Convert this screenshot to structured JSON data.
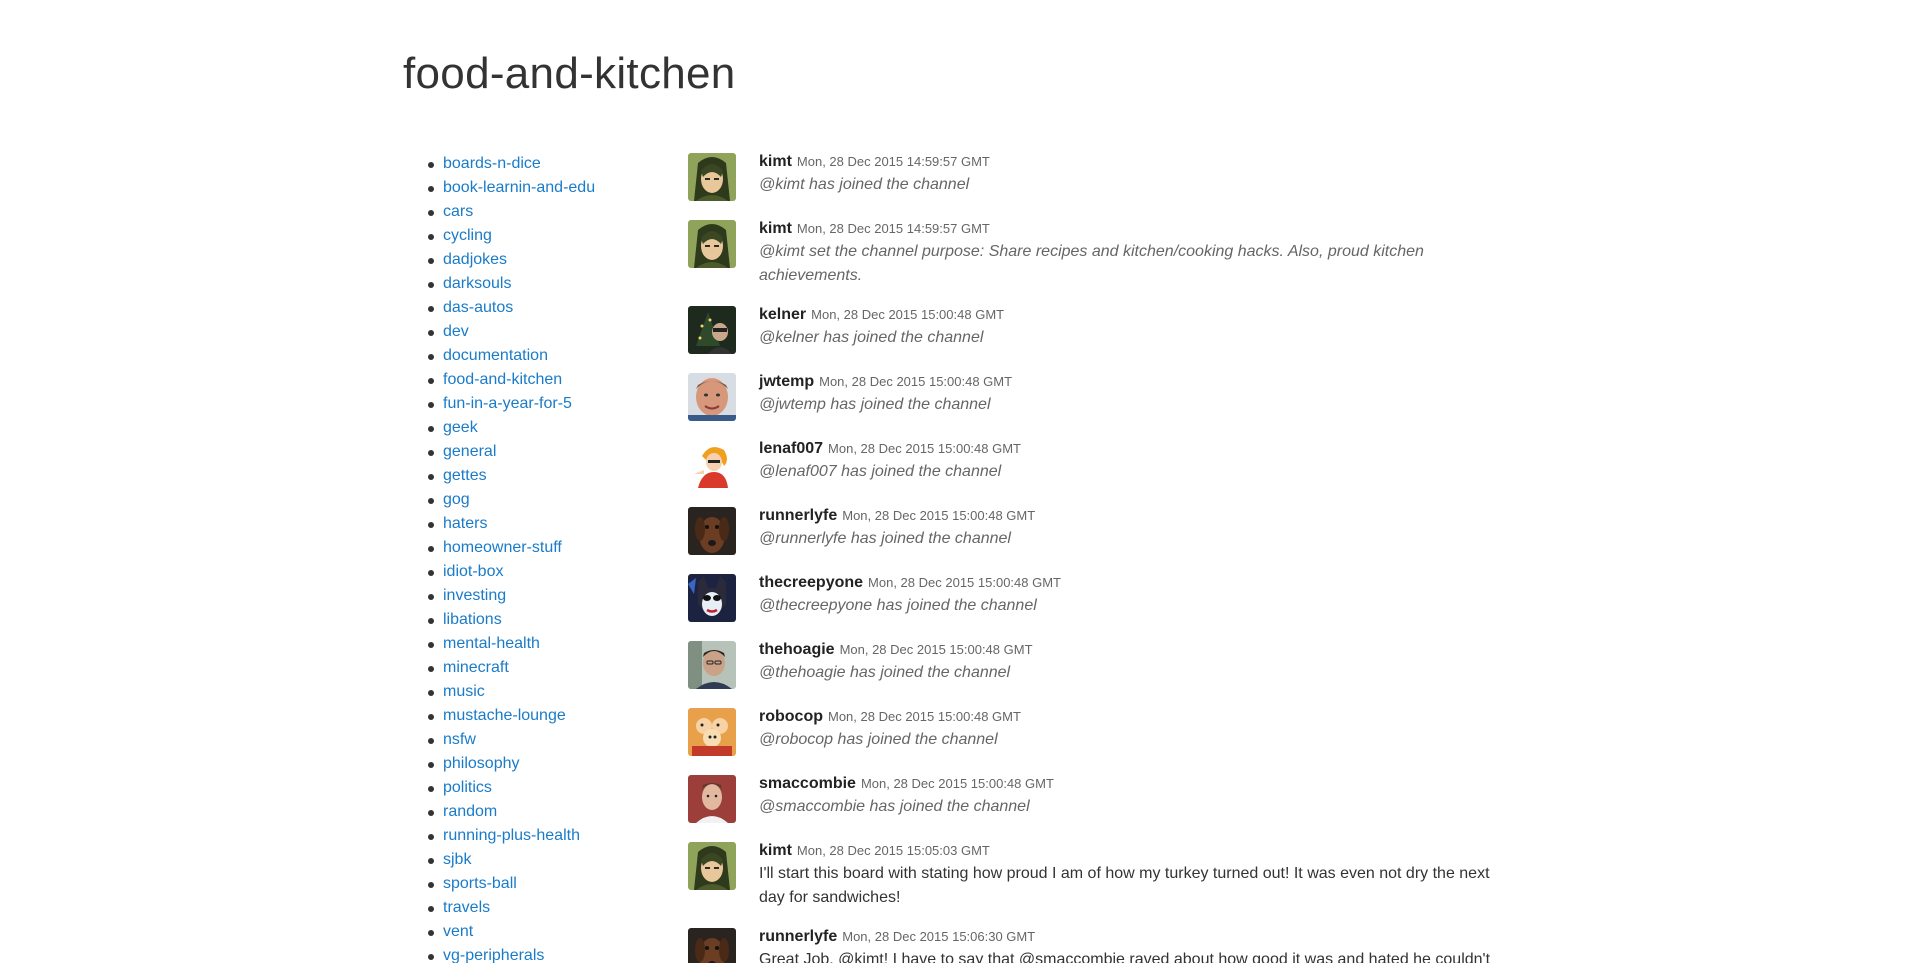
{
  "page": {
    "title": "food-and-kitchen"
  },
  "channels": [
    "boards-n-dice",
    "book-learnin-and-edu",
    "cars",
    "cycling",
    "dadjokes",
    "darksouls",
    "das-autos",
    "dev",
    "documentation",
    "food-and-kitchen",
    "fun-in-a-year-for-5",
    "geek",
    "general",
    "gettes",
    "gog",
    "haters",
    "homeowner-stuff",
    "idiot-box",
    "investing",
    "libations",
    "mental-health",
    "minecraft",
    "music",
    "mustache-lounge",
    "nsfw",
    "philosophy",
    "politics",
    "random",
    "running-plus-health",
    "sjbk",
    "sports-ball",
    "travels",
    "vent",
    "vg-peripherals"
  ],
  "messages": [
    {
      "user": "kimt",
      "time": "Mon, 28 Dec 2015 14:59:57 GMT",
      "text": "@kimt has joined the channel",
      "system": true,
      "avatar": "anime-portrait-avatar"
    },
    {
      "user": "kimt",
      "time": "Mon, 28 Dec 2015 14:59:57 GMT",
      "text": "@kimt set the channel purpose: Share recipes and kitchen/cooking hacks. Also, proud kitchen achievements.",
      "system": true,
      "avatar": "anime-portrait-avatar"
    },
    {
      "user": "kelner",
      "time": "Mon, 28 Dec 2015 15:00:48 GMT",
      "text": "@kelner has joined the channel",
      "system": true,
      "avatar": "christmas-tree-photo-avatar"
    },
    {
      "user": "jwtemp",
      "time": "Mon, 28 Dec 2015 15:00:48 GMT",
      "text": "@jwtemp has joined the channel",
      "system": true,
      "avatar": "face-photo-avatar"
    },
    {
      "user": "lenaf007",
      "time": "Mon, 28 Dec 2015 15:00:48 GMT",
      "text": "@lenaf007 has joined the channel",
      "system": true,
      "avatar": "cartoon-woman-avatar"
    },
    {
      "user": "runnerlyfe",
      "time": "Mon, 28 Dec 2015 15:00:48 GMT",
      "text": "@runnerlyfe has joined the channel",
      "system": true,
      "avatar": "dog-photo-avatar"
    },
    {
      "user": "thecreepyone",
      "time": "Mon, 28 Dec 2015 15:00:48 GMT",
      "text": "@thecreepyone has joined the channel",
      "system": true,
      "avatar": "masked-villain-avatar"
    },
    {
      "user": "thehoagie",
      "time": "Mon, 28 Dec 2015 15:00:48 GMT",
      "text": "@thehoagie has joined the channel",
      "system": true,
      "avatar": "man-photo-avatar"
    },
    {
      "user": "robocop",
      "time": "Mon, 28 Dec 2015 15:00:48 GMT",
      "text": "@robocop has joined the channel",
      "system": true,
      "avatar": "cartoon-group-avatar"
    },
    {
      "user": "smaccombie",
      "time": "Mon, 28 Dec 2015 15:00:48 GMT",
      "text": "@smaccombie has joined the channel",
      "system": true,
      "avatar": "man-red-background-avatar"
    },
    {
      "user": "kimt",
      "time": "Mon, 28 Dec 2015 15:05:03 GMT",
      "text": "I'll start this board with stating how proud I am of how my turkey turned out! It was even not dry the next day for sandwiches!",
      "system": false,
      "avatar": "anime-portrait-avatar"
    },
    {
      "user": "runnerlyfe",
      "time": "Mon, 28 Dec 2015 15:06:30 GMT",
      "text": "Great Job, @kimt! I have to say that @smaccombie raved about how good it was and hated he couldn't",
      "system": false,
      "avatar": "dog-photo-avatar"
    }
  ]
}
